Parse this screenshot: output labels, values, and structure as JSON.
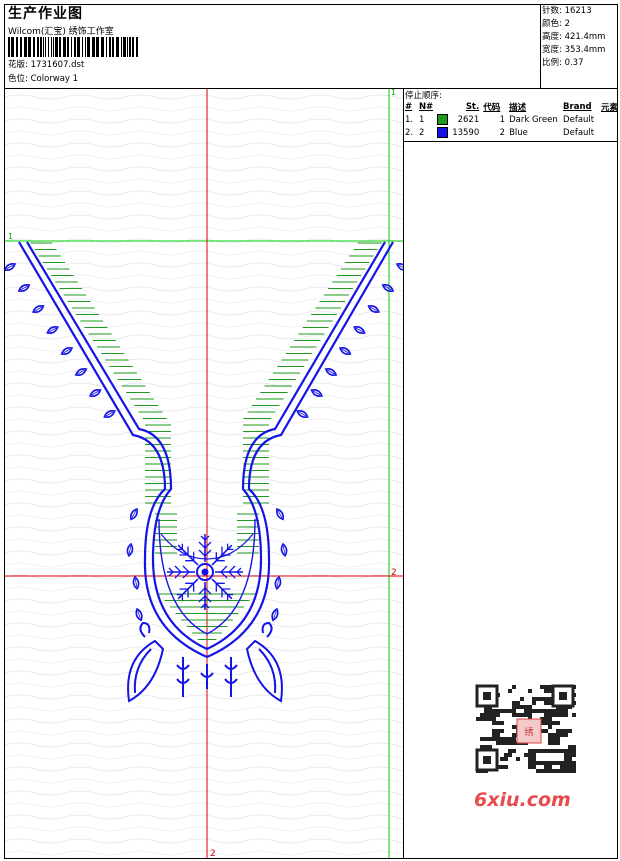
{
  "header": {
    "title": "生产作业图",
    "subtitle": "Wilcom(汇宝) 绣饰工作室",
    "file_label": "花版: 1731607.dst",
    "colorway_label": "色位: Colorway 1"
  },
  "specs": {
    "stitches": "针数: 16213",
    "colors": "颜色: 2",
    "height": "高度: 421.4mm",
    "width": "宽度: 353.4mm",
    "scale": "比例: 0.37"
  },
  "stop_sequence": {
    "title": "停止顺序:",
    "headers": [
      "#",
      "N#",
      "",
      "St.",
      "代码",
      "描述",
      "Brand",
      "元素"
    ],
    "rows": [
      {
        "idx": "1.",
        "n": "1",
        "color": "#1e9a1e",
        "st": "2621",
        "code": "1",
        "desc": "Dark Green",
        "brand": "Default"
      },
      {
        "idx": "2.",
        "n": "2",
        "color": "#1414e6",
        "st": "13590",
        "code": "2",
        "desc": "Blue",
        "brand": "Default"
      }
    ]
  },
  "markers": {
    "top_left": "1",
    "top_right": "1",
    "right_mid": "2",
    "bottom": "2"
  },
  "watermark": "6xiu.com",
  "colors": {
    "green": "#1e9a1e",
    "blue": "#1414e6",
    "guide_red": "#dd0000",
    "guide_green": "#00cc00"
  }
}
